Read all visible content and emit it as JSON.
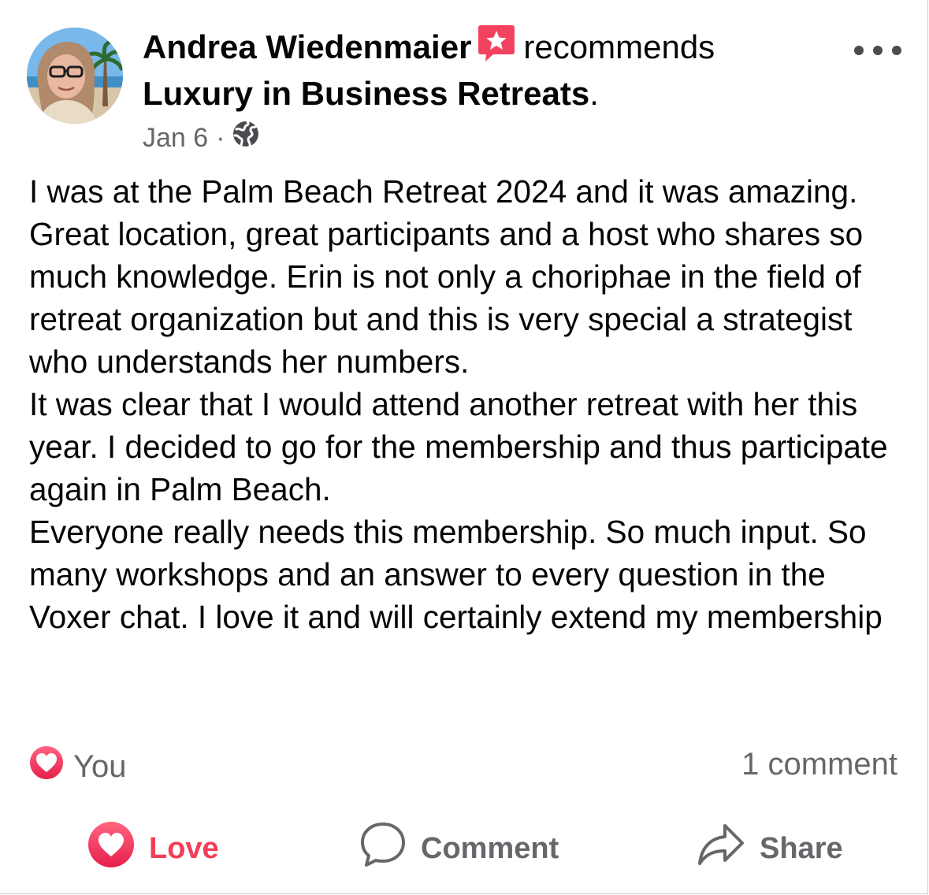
{
  "post": {
    "author_name": "Andrea Wiedenmaier",
    "recommends_text": "recommends",
    "page_name": "Luxury in Business Retreats",
    "page_suffix": ".",
    "date": "Jan 6",
    "separator": "·",
    "privacy_icon": "globe-icon",
    "more_icon": "more-options-icon",
    "paragraphs": [
      "I was at the Palm Beach Retreat 2024 and it was amazing. Great location, great participants and a host who shares so much knowledge. Erin is not only a choriphae in the field of retreat organization but and this is very special a strategist who understands her numbers.",
      "It was clear that I would attend another retreat with her this year. I decided to go for the membership and thus participate again in Palm Beach.",
      "Everyone really needs this membership. So much input. So many workshops and an answer to every question in the Voxer chat. I love it and will certainly extend my membership"
    ]
  },
  "reactions": {
    "icon": "love-reaction-icon",
    "reactor_text": "You",
    "comments_text": "1 comment"
  },
  "actions": {
    "love_label": "Love",
    "comment_label": "Comment",
    "share_label": "Share"
  },
  "colors": {
    "love": "#f33e58",
    "badge": "#f3425f",
    "secondary_text": "#65676b",
    "primary_text": "#050505"
  }
}
